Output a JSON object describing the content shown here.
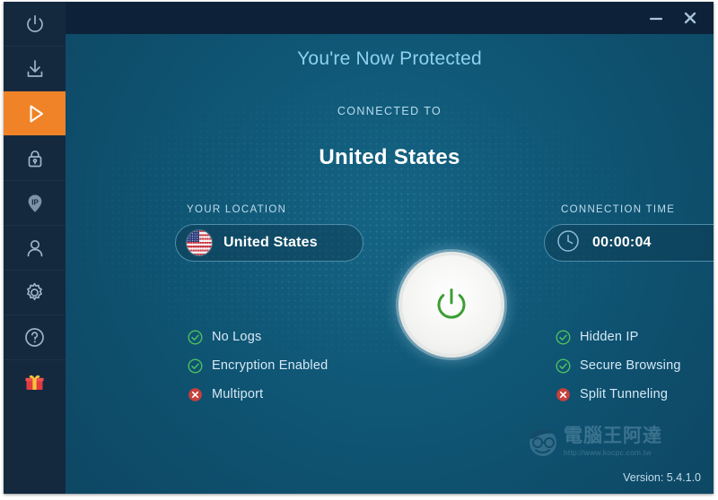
{
  "window": {
    "titlebar": {
      "minimize_label": "minimize",
      "close_label": "close"
    }
  },
  "sidebar": {
    "items": [
      {
        "icon": "power-icon",
        "name": "sidebar-item-power",
        "active": false
      },
      {
        "icon": "download-icon",
        "name": "sidebar-item-download",
        "active": false
      },
      {
        "icon": "play-icon",
        "name": "sidebar-item-connect",
        "active": true
      },
      {
        "icon": "lock-icon",
        "name": "sidebar-item-security",
        "active": false
      },
      {
        "icon": "ip-pin-icon",
        "name": "sidebar-item-ip",
        "active": false
      },
      {
        "icon": "user-icon",
        "name": "sidebar-item-account",
        "active": false
      },
      {
        "icon": "gear-icon",
        "name": "sidebar-item-settings",
        "active": false
      },
      {
        "icon": "help-icon",
        "name": "sidebar-item-help",
        "active": false
      },
      {
        "icon": "gift-icon",
        "name": "sidebar-item-rewards",
        "active": false
      }
    ],
    "active_color": "#f08327"
  },
  "main": {
    "headline": "You're Now Protected",
    "connected_to_label": "CONNECTED TO",
    "country": "United States",
    "location": {
      "label": "YOUR LOCATION",
      "value": "United States",
      "flag": "us-flag-icon"
    },
    "connection_time": {
      "label": "CONNECTION TIME",
      "value": "00:00:04",
      "icon": "clock-icon"
    },
    "power_button": {
      "name": "power-toggle-button",
      "state": "on",
      "icon_color": "#3d9e33"
    },
    "features_left": [
      {
        "label": "No Logs",
        "status": "enabled"
      },
      {
        "label": "Encryption Enabled",
        "status": "enabled"
      },
      {
        "label": "Multiport",
        "status": "disabled"
      }
    ],
    "features_right": [
      {
        "label": "Hidden IP",
        "status": "enabled"
      },
      {
        "label": "Secure Browsing",
        "status": "enabled"
      },
      {
        "label": "Split Tunneling",
        "status": "disabled"
      }
    ]
  },
  "footer": {
    "version": "Version: 5.4.1.0",
    "watermark": {
      "title": "電腦王阿達",
      "url": "http://www.kocpc.com.tw"
    }
  },
  "colors": {
    "titlebar_bg": "#0d2238",
    "sidebar_bg": "#14283e",
    "content_bg": "#0f5574",
    "accent_orange": "#f08327",
    "status_ok": "#4fbf62",
    "status_off": "#e0413d",
    "headline_blue": "#8fd0ef"
  }
}
